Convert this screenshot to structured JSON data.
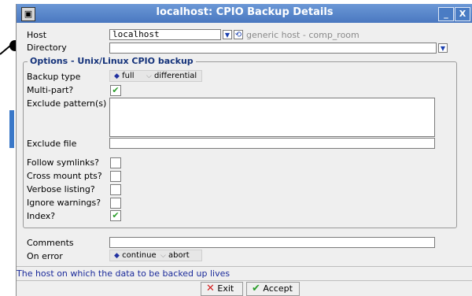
{
  "window": {
    "title": "localhost: CPIO Backup Details",
    "minimize_label": "_",
    "close_label": "X"
  },
  "host": {
    "label": "Host",
    "value": "localhost",
    "refresh_icon": "refresh-icon",
    "description": "generic host - comp_room"
  },
  "directory": {
    "label": "Directory",
    "value": ""
  },
  "options": {
    "group_title": "Options - Unix/Linux CPIO backup",
    "backup_type": {
      "label": "Backup type",
      "options": [
        "full",
        "differential"
      ],
      "selected": "full"
    },
    "multi_part": {
      "label": "Multi-part?",
      "checked": true
    },
    "exclude_patterns": {
      "label": "Exclude pattern(s)",
      "value": ""
    },
    "exclude_file": {
      "label": "Exclude file",
      "value": ""
    },
    "follow_symlinks": {
      "label": "Follow symlinks?",
      "checked": false
    },
    "cross_mount": {
      "label": "Cross mount pts?",
      "checked": false
    },
    "verbose": {
      "label": "Verbose listing?",
      "checked": false
    },
    "ignore_warnings": {
      "label": "Ignore warnings?",
      "checked": false
    },
    "index": {
      "label": "Index?",
      "checked": true
    }
  },
  "comments": {
    "label": "Comments",
    "value": ""
  },
  "on_error": {
    "label": "On error",
    "options": [
      "continue",
      "abort"
    ],
    "selected": "continue"
  },
  "status_text": "The host on which the data to be backed up lives",
  "buttons": {
    "exit": "Exit",
    "accept": "Accept"
  },
  "colors": {
    "titlebar": "#5585cb",
    "status_text": "#1a2a9a",
    "check": "#2a9d2a",
    "exit_icon": "#d42020"
  }
}
